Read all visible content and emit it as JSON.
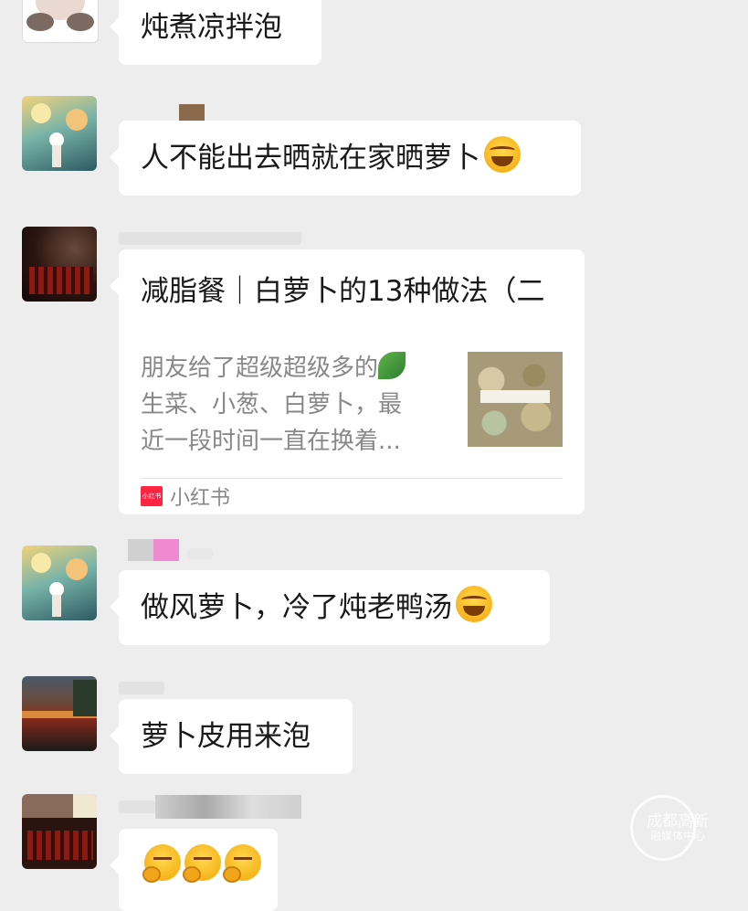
{
  "messages": [
    {
      "text": "炖煮凉拌泡",
      "emoji": []
    },
    {
      "text": "人不能出去晒就在家晒萝卜",
      "emoji": [
        "laugh"
      ]
    },
    {
      "text": "做风萝卜，冷了炖老鸭汤",
      "emoji": [
        "laugh"
      ]
    },
    {
      "text": "萝卜皮用来泡",
      "emoji": []
    },
    {
      "text": "",
      "emoji": [
        "think",
        "think",
        "think"
      ]
    }
  ],
  "card": {
    "title": "减脂餐｜白萝卜的13种做法（二",
    "desc_line1": "朋友给了超级超级多的",
    "desc_line2": "生菜、小葱、白萝卜，最",
    "desc_line3": "近一段时间一直在换着...",
    "source": "小红书",
    "logo_text": "小红书"
  },
  "watermark": {
    "line1": "成都高新",
    "line2": "融媒体中心"
  },
  "colors": {
    "background": "#ededed",
    "bubble": "#ffffff",
    "xhs_brand": "#ff2442"
  }
}
